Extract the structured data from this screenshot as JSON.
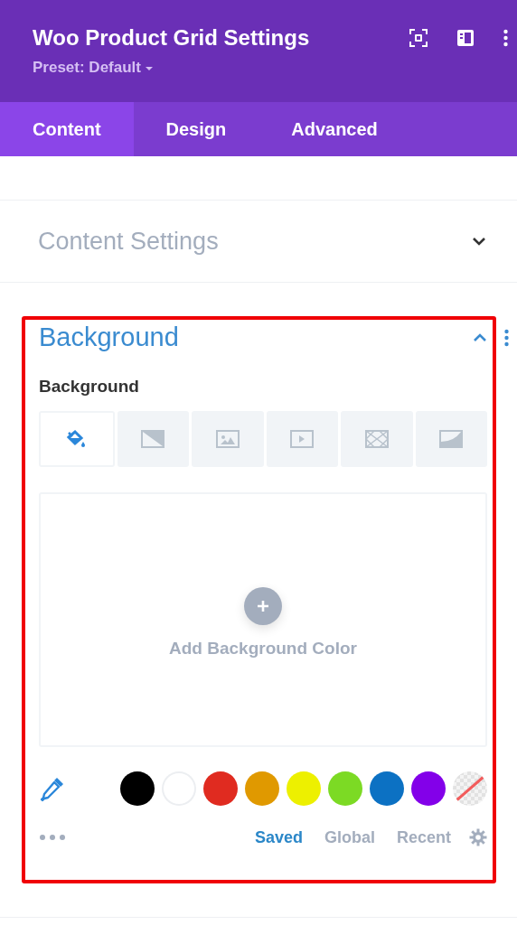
{
  "header": {
    "title": "Woo Product Grid Settings",
    "preset": "Preset: Default"
  },
  "tabs": [
    {
      "label": "Content",
      "selected": true
    },
    {
      "label": "Design",
      "selected": false
    },
    {
      "label": "Advanced",
      "selected": false
    }
  ],
  "content_settings": {
    "title": "Content Settings",
    "expanded": false
  },
  "background": {
    "title": "Background",
    "expanded": true,
    "field_label": "Background",
    "types": [
      {
        "kind": "color",
        "selected": true
      },
      {
        "kind": "gradient",
        "selected": false
      },
      {
        "kind": "image",
        "selected": false
      },
      {
        "kind": "video",
        "selected": false
      },
      {
        "kind": "pattern",
        "selected": false
      },
      {
        "kind": "mask",
        "selected": false
      }
    ],
    "add_color_label": "Add Background Color",
    "swatches": [
      {
        "kind": "color",
        "color": "#000000"
      },
      {
        "kind": "color",
        "color": "#ffffff"
      },
      {
        "kind": "color",
        "color": "#e02b20"
      },
      {
        "kind": "color",
        "color": "#e09900"
      },
      {
        "kind": "color",
        "color": "#edf000"
      },
      {
        "kind": "color",
        "color": "#7cda24"
      },
      {
        "kind": "color",
        "color": "#0c71c3"
      },
      {
        "kind": "color",
        "color": "#8300e9"
      },
      {
        "kind": "clear"
      }
    ],
    "palette_tabs": [
      {
        "label": "Saved",
        "selected": true
      },
      {
        "label": "Global",
        "selected": false
      },
      {
        "label": "Recent",
        "selected": false
      }
    ]
  }
}
